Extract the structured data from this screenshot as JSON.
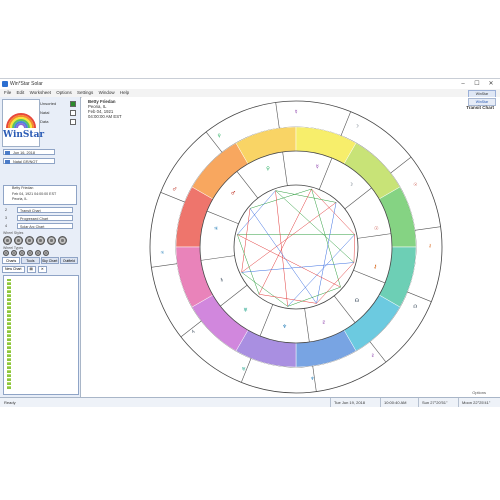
{
  "window": {
    "title": "Win*Star Solar",
    "controls": [
      "–",
      "☐",
      "✕"
    ]
  },
  "menu": {
    "items": [
      "File",
      "Edit",
      "Worksheet",
      "Options",
      "Settings",
      "Window",
      "Help"
    ],
    "brand_badge": "WinStar"
  },
  "sidebar": {
    "logo_text": "WinStar",
    "toggles": [
      {
        "label": "Unsorted",
        "checked": true
      },
      {
        "label": "Natal",
        "checked": false
      },
      {
        "label": "Data",
        "checked": false
      }
    ],
    "dates": [
      "Jun 16, 2018",
      "Natal GR/NOT"
    ],
    "person": {
      "lines": [
        "Betty Friedan",
        "Feb 04, 1921 04:00:00 EST",
        "Peoria, IL"
      ]
    },
    "chart_selects": [
      {
        "num": "2",
        "value": "Transit Chart"
      },
      {
        "num": "3",
        "value": "Progressed Chart"
      },
      {
        "num": "4",
        "value": "Solar Arc Chart"
      }
    ],
    "wheel_styles_label": "Wheel Styles",
    "wheel_types_label": "Wheel Types",
    "tabs": [
      "Charts",
      "Tools",
      "Sky Chart",
      "Outfield"
    ],
    "new_chart_label": "New Chart"
  },
  "chart": {
    "info": {
      "name": "Betty Friedan",
      "place": "Peoria, IL",
      "date": "Feb 04, 1921",
      "time": "04:00:00 AM EST"
    },
    "type_label": "Transit Chart",
    "brand": "WinStar",
    "options_label": "Options"
  },
  "status": {
    "left": "Ready",
    "segments": [
      "Tue Jun 19, 2018",
      "10:00:40 AM",
      "Sun 27°20'51\"",
      "Moon 22°25'41\""
    ]
  },
  "colors": {
    "zodiac": [
      "#e8473b",
      "#f58a2a",
      "#f7c531",
      "#f4e83a",
      "#b6d94a",
      "#5cc45a",
      "#3cbf9c",
      "#3bb8d6",
      "#4b86d9",
      "#8c6ad7",
      "#c25fd1",
      "#e25aa3"
    ]
  }
}
